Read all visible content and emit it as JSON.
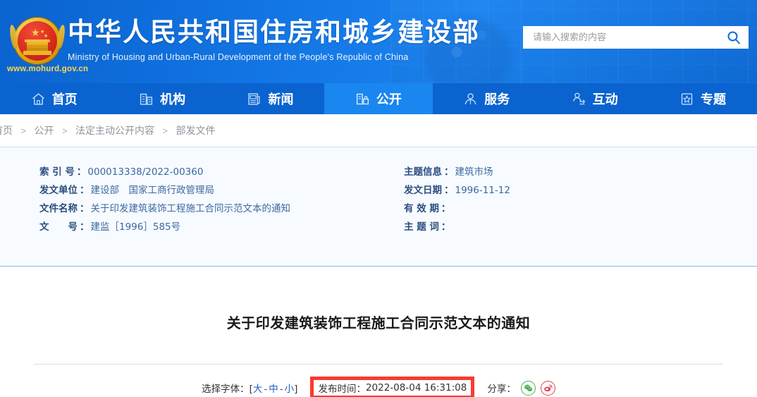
{
  "header": {
    "site_title_cn": "中华人民共和国住房和城乡建设部",
    "site_title_en": "Ministry of Housing and Urban-Rural Development of the People's Republic of China",
    "site_url": "www.mohurd.gov.cn",
    "emblem_name": "national-emblem",
    "brand_blue": "#0a63cf",
    "accent_gold": "#ffd84a"
  },
  "search": {
    "placeholder": "请输入搜索的内容",
    "value": "",
    "icon": "search-icon"
  },
  "nav": {
    "items": [
      {
        "label": "首页",
        "icon": "home-icon",
        "active": false
      },
      {
        "label": "机构",
        "icon": "building-icon",
        "active": false
      },
      {
        "label": "新闻",
        "icon": "newspaper-icon",
        "active": false
      },
      {
        "label": "公开",
        "icon": "open-document-icon",
        "active": true
      },
      {
        "label": "服务",
        "icon": "service-person-icon",
        "active": false
      },
      {
        "label": "互动",
        "icon": "interaction-icon",
        "active": false
      },
      {
        "label": "专题",
        "icon": "star-box-icon",
        "active": false
      }
    ],
    "active_bg": "#1a86f0"
  },
  "breadcrumb": {
    "items": [
      "首页",
      "公开",
      "法定主动公开内容",
      "部发文件"
    ],
    "separator": ">"
  },
  "meta": {
    "left": [
      {
        "key": "索 引 号",
        "value": "000013338/2022-00360"
      },
      {
        "key": "发文单位",
        "value": "建设部　国家工商行政管理局"
      },
      {
        "key": "文件名称",
        "value": "关于印发建筑装饰工程施工合同示范文本的通知"
      },
      {
        "key": "文　　号",
        "value": "建监［1996］585号"
      }
    ],
    "right": [
      {
        "key": "主题信息",
        "value": "建筑市场"
      },
      {
        "key": "发文日期",
        "value": "1996-11-12"
      },
      {
        "key": "有 效 期",
        "value": ""
      },
      {
        "key": "主 题 词",
        "value": ""
      }
    ],
    "colon": "："
  },
  "article": {
    "title": "关于印发建筑装饰工程施工合同示范文本的通知",
    "font_picker": {
      "label": "选择字体：",
      "bracket_open": "[",
      "bracket_close": "]",
      "sizes": [
        "大",
        "中",
        "小"
      ],
      "dash": "-"
    },
    "publish_time": {
      "label": "发布时间：",
      "value": "2022-08-04 16:31:08",
      "highlight_color": "#f93a2f"
    },
    "share": {
      "label": "分享：",
      "channels": [
        {
          "name": "wechat-share-icon",
          "color": "#4caf50"
        },
        {
          "name": "weibo-share-icon",
          "color": "#e8404a"
        }
      ]
    }
  }
}
